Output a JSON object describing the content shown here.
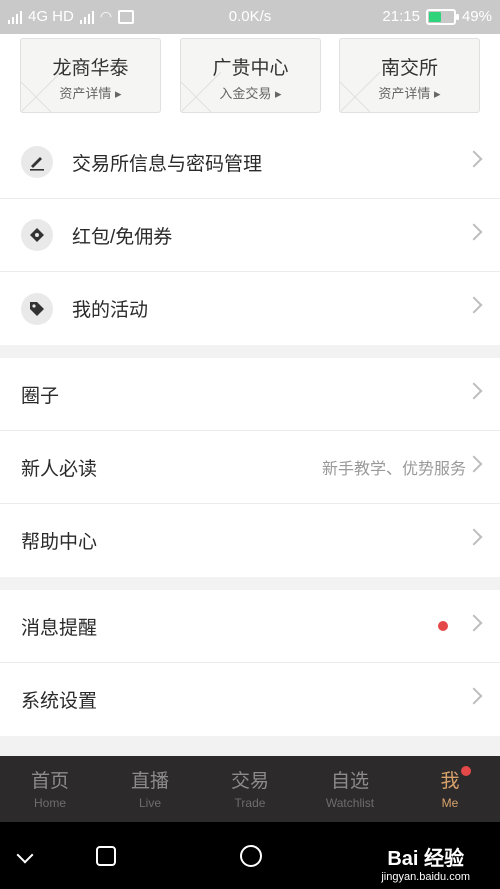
{
  "status_bar": {
    "network": "4G HD",
    "speed": "0.0K/s",
    "time": "21:15",
    "battery": "49%",
    "battery_level": 0.49
  },
  "exchanges": [
    {
      "name": "龙商华泰",
      "sub": "资产详情 ▸"
    },
    {
      "name": "广贵中心",
      "sub": "入金交易 ▸"
    },
    {
      "name": "南交所",
      "sub": "资产详情 ▸"
    }
  ],
  "section1": [
    {
      "label": "交易所信息与密码管理",
      "icon": "pencil-icon"
    },
    {
      "label": "红包/免佣券",
      "icon": "ticket-icon"
    },
    {
      "label": "我的活动",
      "icon": "tag-icon"
    }
  ],
  "section2": [
    {
      "label": "圈子"
    },
    {
      "label": "新人必读",
      "hint": "新手教学、优势服务"
    },
    {
      "label": "帮助中心"
    }
  ],
  "section3": [
    {
      "label": "消息提醒"
    },
    {
      "label": "系统设置"
    }
  ],
  "tabs": [
    {
      "zh": "首页",
      "en": "Home"
    },
    {
      "zh": "直播",
      "en": "Live"
    },
    {
      "zh": "交易",
      "en": "Trade"
    },
    {
      "zh": "自选",
      "en": "Watchlist"
    },
    {
      "zh": "我",
      "en": "Me"
    }
  ],
  "watermark": {
    "main": "Bai 经验",
    "sub": "jingyan.baidu.com"
  },
  "colors": {
    "accent": "#d6a26a",
    "badge": "#e54848",
    "tabbar": "#2d2a2c"
  }
}
